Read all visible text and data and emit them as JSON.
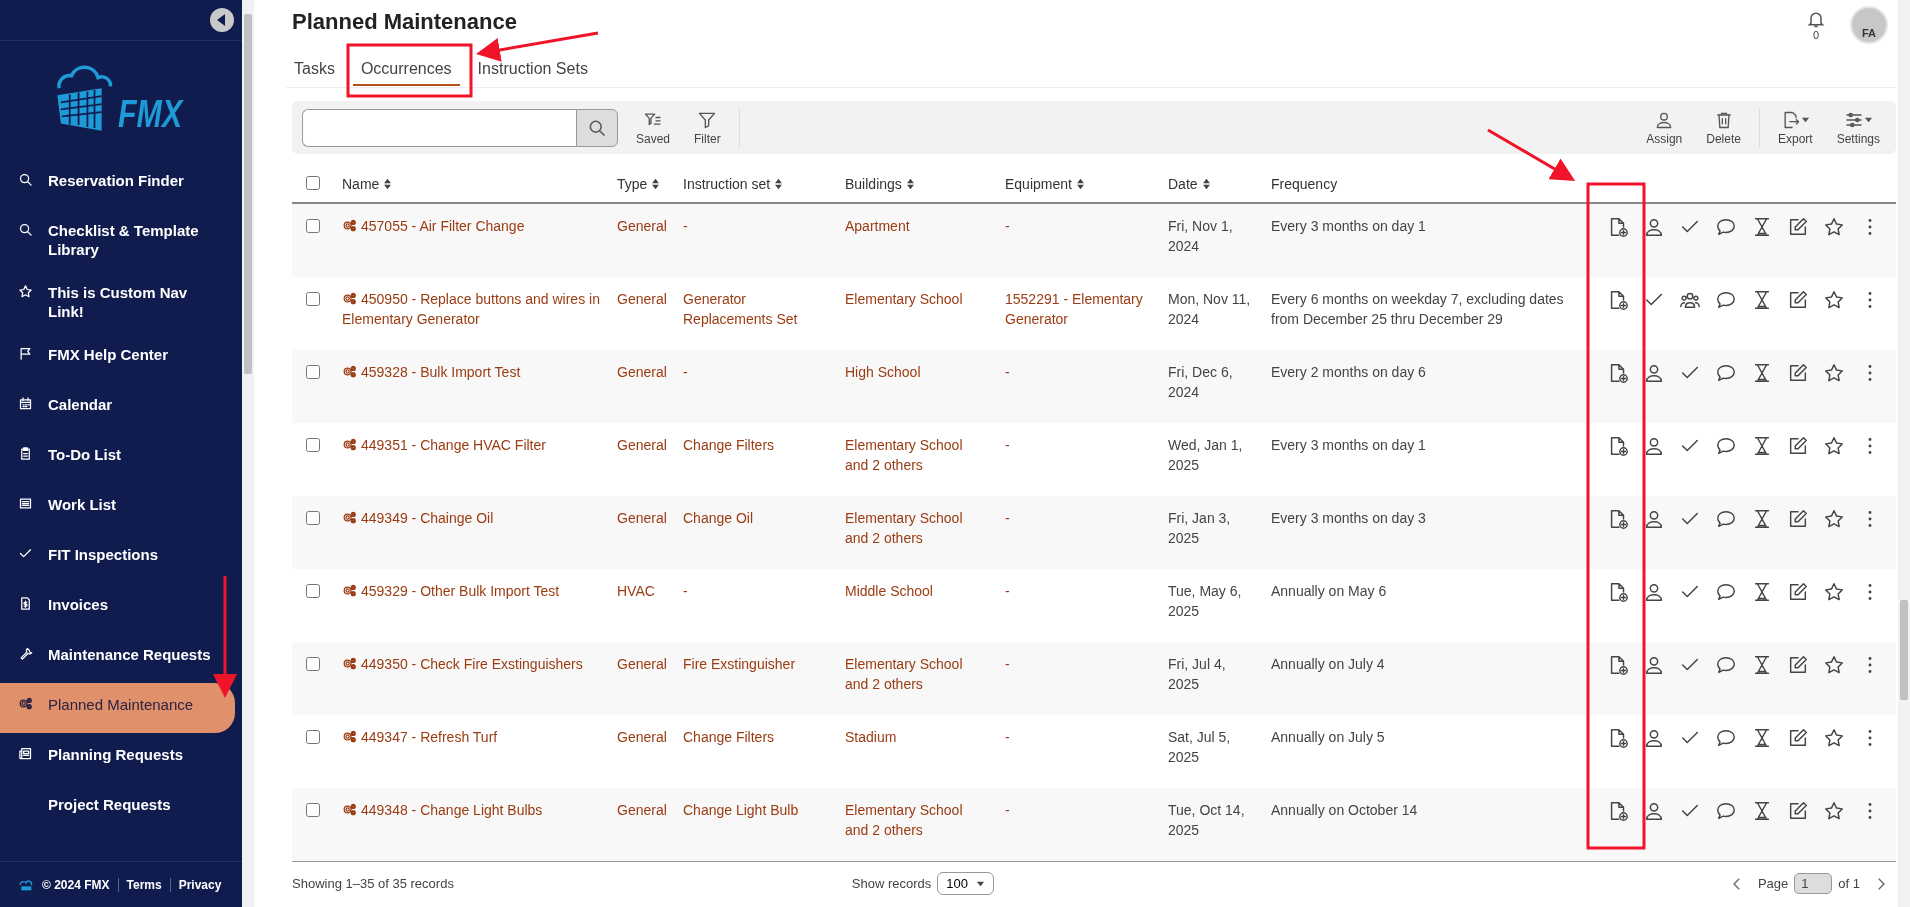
{
  "sidebar": {
    "logo_text": "FMX",
    "nav_items": [
      {
        "label": "Reservation Finder",
        "kind": "search",
        "selected": false
      },
      {
        "label": "Checklist & Template Library",
        "kind": "search",
        "selected": false
      },
      {
        "label": "This is Custom Nav Link!",
        "kind": "star",
        "selected": false
      },
      {
        "label": "FMX Help Center",
        "kind": "flag",
        "selected": false
      },
      {
        "label": "Calendar",
        "kind": "calendar",
        "selected": false
      },
      {
        "label": "To-Do List",
        "kind": "clipboard",
        "selected": false
      },
      {
        "label": "Work List",
        "kind": "list",
        "selected": false
      },
      {
        "label": "FIT Inspections",
        "kind": "check",
        "selected": false
      },
      {
        "label": "Invoices",
        "kind": "invoice",
        "selected": false
      },
      {
        "label": "Maintenance Requests",
        "kind": "wrench",
        "selected": false
      },
      {
        "label": "Planned Maintenance",
        "kind": "gears",
        "selected": true
      },
      {
        "label": "Planning Requests",
        "kind": "newspaper",
        "selected": false
      },
      {
        "label": "Project Requests",
        "kind": "none",
        "selected": false
      }
    ],
    "footer": {
      "copyright": "© 2024 FMX",
      "links": [
        "Terms",
        "Privacy"
      ]
    }
  },
  "header": {
    "title": "Planned Maintenance",
    "notifications": "0",
    "avatar": "FA"
  },
  "tabs": [
    {
      "label": "Tasks",
      "selected": false
    },
    {
      "label": "Occurrences",
      "selected": true
    },
    {
      "label": "Instruction Sets",
      "selected": false
    }
  ],
  "toolbar": {
    "left_buttons": [
      {
        "label": "Saved",
        "kind": "saved"
      },
      {
        "label": "Filter",
        "kind": "filter"
      }
    ],
    "right_buttons": [
      {
        "label": "Assign",
        "kind": "assign"
      },
      {
        "label": "Delete",
        "kind": "delete"
      },
      {
        "label": "Export",
        "kind": "export"
      },
      {
        "label": "Settings",
        "kind": "settings"
      }
    ]
  },
  "table": {
    "select_all": {
      "checked": false
    },
    "columns": [
      {
        "label": "Name",
        "sortable": true
      },
      {
        "label": "Type",
        "sortable": true
      },
      {
        "label": "Instruction set",
        "sortable": true
      },
      {
        "label": "Buildings",
        "sortable": true
      },
      {
        "label": "Equipment",
        "sortable": true
      },
      {
        "label": "Date",
        "sortable": true
      },
      {
        "label": "Frequency",
        "sortable": false
      }
    ],
    "rows": [
      {
        "checked": false,
        "name": "457055 - Air Filter Change",
        "type": "General",
        "instruction_set": "-",
        "buildings": "Apartment",
        "equipment": "-",
        "date": "Fri, Nov 1, 2024",
        "frequency": "Every 3 months on day 1",
        "actions": [
          {
            "kind": "add-file"
          },
          {
            "kind": "assign"
          },
          {
            "kind": "complete"
          },
          {
            "kind": "comment"
          },
          {
            "kind": "hourglass"
          },
          {
            "kind": "edit"
          },
          {
            "kind": "favorite"
          },
          {
            "kind": "more"
          }
        ]
      },
      {
        "checked": false,
        "name": "450950 - Replace buttons and wires in Elementary Generator",
        "type": "General",
        "instruction_set": "Generator Replacements Set",
        "buildings": "Elementary School",
        "equipment": "1552291 - Elementary Generator",
        "date": "Mon, Nov 11, 2024",
        "frequency": "Every 6 months on weekday 7, excluding dates from December 25 thru December 29",
        "actions": [
          {
            "kind": "add-file"
          },
          {
            "kind": "complete"
          },
          {
            "kind": "team"
          },
          {
            "kind": "comment"
          },
          {
            "kind": "hourglass"
          },
          {
            "kind": "edit"
          },
          {
            "kind": "favorite"
          },
          {
            "kind": "more"
          }
        ]
      },
      {
        "checked": false,
        "name": "459328 - Bulk Import Test",
        "type": "General",
        "instruction_set": "-",
        "buildings": "High School",
        "equipment": "-",
        "date": "Fri, Dec 6, 2024",
        "frequency": "Every 2 months on day 6",
        "actions": [
          {
            "kind": "add-file"
          },
          {
            "kind": "assign"
          },
          {
            "kind": "complete"
          },
          {
            "kind": "comment"
          },
          {
            "kind": "hourglass"
          },
          {
            "kind": "edit"
          },
          {
            "kind": "favorite"
          },
          {
            "kind": "more"
          }
        ]
      },
      {
        "checked": false,
        "name": "449351 - Change HVAC Filter",
        "type": "General",
        "instruction_set": "Change Filters",
        "buildings": "Elementary School and 2 others",
        "equipment": "-",
        "date": "Wed, Jan 1, 2025",
        "frequency": "Every 3 months on day 1",
        "actions": [
          {
            "kind": "add-file"
          },
          {
            "kind": "assign"
          },
          {
            "kind": "complete"
          },
          {
            "kind": "comment"
          },
          {
            "kind": "hourglass"
          },
          {
            "kind": "edit"
          },
          {
            "kind": "favorite"
          },
          {
            "kind": "more"
          }
        ]
      },
      {
        "checked": false,
        "name": "449349 - Chainge Oil",
        "type": "General",
        "instruction_set": "Change Oil",
        "buildings": "Elementary School and 2 others",
        "equipment": "-",
        "date": "Fri, Jan 3, 2025",
        "frequency": "Every 3 months on day 3",
        "actions": [
          {
            "kind": "add-file"
          },
          {
            "kind": "assign"
          },
          {
            "kind": "complete"
          },
          {
            "kind": "comment"
          },
          {
            "kind": "hourglass"
          },
          {
            "kind": "edit"
          },
          {
            "kind": "favorite"
          },
          {
            "kind": "more"
          }
        ]
      },
      {
        "checked": false,
        "name": "459329 - Other Bulk Import Test",
        "type": "HVAC",
        "instruction_set": "-",
        "buildings": "Middle School",
        "equipment": "-",
        "date": "Tue, May 6, 2025",
        "frequency": "Annually on May 6",
        "actions": [
          {
            "kind": "add-file"
          },
          {
            "kind": "assign"
          },
          {
            "kind": "complete"
          },
          {
            "kind": "comment"
          },
          {
            "kind": "hourglass"
          },
          {
            "kind": "edit"
          },
          {
            "kind": "favorite"
          },
          {
            "kind": "more"
          }
        ]
      },
      {
        "checked": false,
        "name": "449350 - Check Fire Exstinguishers",
        "type": "General",
        "instruction_set": "Fire Exstinguisher",
        "buildings": "Elementary School and 2 others",
        "equipment": "-",
        "date": "Fri, Jul 4, 2025",
        "frequency": "Annually on July 4",
        "actions": [
          {
            "kind": "add-file"
          },
          {
            "kind": "assign"
          },
          {
            "kind": "complete"
          },
          {
            "kind": "comment"
          },
          {
            "kind": "hourglass"
          },
          {
            "kind": "edit"
          },
          {
            "kind": "favorite"
          },
          {
            "kind": "more"
          }
        ]
      },
      {
        "checked": false,
        "name": "449347 - Refresh Turf",
        "type": "General",
        "instruction_set": "Change Filters",
        "buildings": "Stadium",
        "equipment": "-",
        "date": "Sat, Jul 5, 2025",
        "frequency": "Annually on July 5",
        "actions": [
          {
            "kind": "add-file"
          },
          {
            "kind": "assign"
          },
          {
            "kind": "complete"
          },
          {
            "kind": "comment"
          },
          {
            "kind": "hourglass"
          },
          {
            "kind": "edit"
          },
          {
            "kind": "favorite"
          },
          {
            "kind": "more"
          }
        ]
      },
      {
        "checked": false,
        "name": "449348 - Change Light Bulbs",
        "type": "General",
        "instruction_set": "Change Light Bulb",
        "buildings": "Elementary School and 2 others",
        "equipment": "-",
        "date": "Tue, Oct 14, 2025",
        "frequency": "Annually on October 14",
        "actions": [
          {
            "kind": "add-file"
          },
          {
            "kind": "assign"
          },
          {
            "kind": "complete"
          },
          {
            "kind": "comment"
          },
          {
            "kind": "hourglass"
          },
          {
            "kind": "edit"
          },
          {
            "kind": "favorite"
          },
          {
            "kind": "more"
          }
        ]
      }
    ]
  },
  "footer": {
    "summary": "Showing 1–35 of 35 records",
    "page_size_label": "Show records",
    "page_size": "100",
    "page_label": "Page",
    "page": "1",
    "page_total": "of 1"
  }
}
